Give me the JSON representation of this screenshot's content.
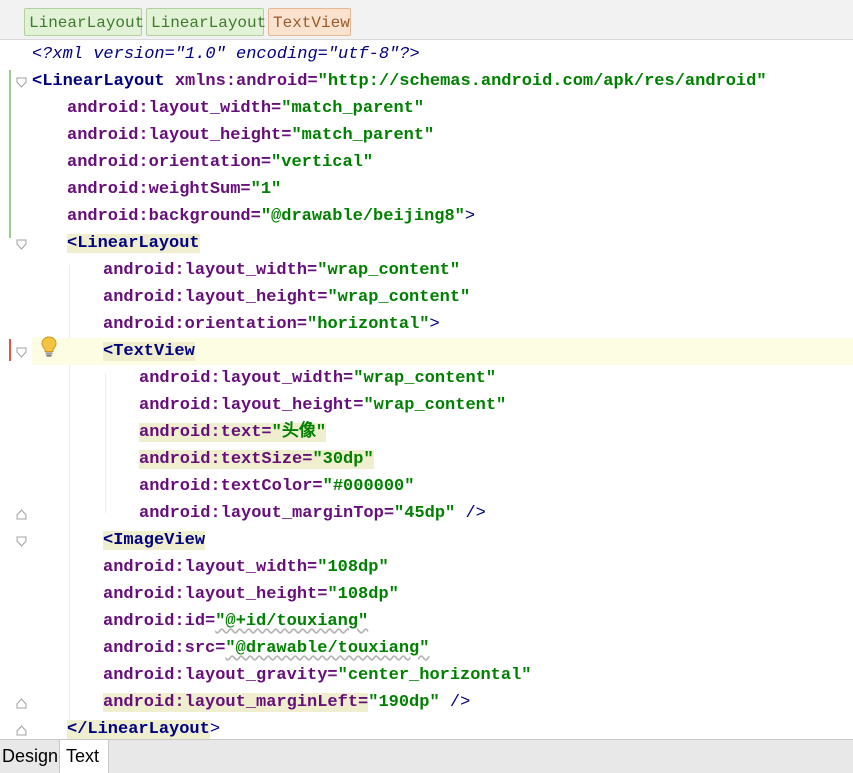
{
  "breadcrumb": {
    "items": [
      {
        "label": "LinearLayout",
        "style": "green"
      },
      {
        "label": "LinearLayout",
        "style": "green"
      },
      {
        "label": "TextView",
        "style": "orange"
      }
    ]
  },
  "editor": {
    "lines": [
      [
        "<?xml version=\"1.0\" encoding=\"utf-8\"?>"
      ],
      [
        "<LinearLayout",
        " xmlns:android=",
        "\"http://schemas.android.com/apk/res/android\""
      ],
      [
        "android:layout_width=",
        "\"match_parent\""
      ],
      [
        "android:layout_height=",
        "\"match_parent\""
      ],
      [
        "android:orientation=",
        "\"vertical\""
      ],
      [
        "android:weightSum=",
        "\"1\""
      ],
      [
        "android:background=",
        "\"@drawable/beijing8\"",
        ">"
      ],
      [
        "<LinearLayout"
      ],
      [
        "android:layout_width=",
        "\"wrap_content\""
      ],
      [
        "android:layout_height=",
        "\"wrap_content\""
      ],
      [
        "android:orientation=",
        "\"horizontal\"",
        ">"
      ],
      [
        "<TextView"
      ],
      [
        "android:layout_width=",
        "\"wrap_content\""
      ],
      [
        "android:layout_height=",
        "\"wrap_content\""
      ],
      [
        "android:text=",
        "\"头像\""
      ],
      [
        "android:textSize=",
        "\"30dp\""
      ],
      [
        "android:textColor=",
        "\"#000000\""
      ],
      [
        "android:layout_marginTop=",
        "\"45dp\"",
        " />"
      ],
      [
        "<ImageView"
      ],
      [
        "android:layout_width=",
        "\"108dp\""
      ],
      [
        "android:layout_height=",
        "\"108dp\""
      ],
      [
        "android:id=",
        "\"@+id/touxiang\""
      ],
      [
        "android:src=",
        "\"@drawable/touxiang\""
      ],
      [
        "android:layout_gravity=",
        "\"center_horizontal\""
      ],
      [
        "android:layout_marginLeft=",
        "\"190dp\"",
        " />"
      ],
      [
        "</LinearLayout",
        ">"
      ]
    ]
  },
  "icons": {
    "intention_bulb": "lightbulb-icon",
    "fold_open": "fold-open-icon",
    "fold_end": "fold-end-icon"
  },
  "colors": {
    "tag": "#000080",
    "attribute": "#660e7a",
    "value": "#008000",
    "caret_line": "#fdfde4",
    "match_highlight": "#efefd0"
  },
  "bottom_tabs": {
    "design": "Design",
    "text": "Text",
    "active": "Text"
  }
}
